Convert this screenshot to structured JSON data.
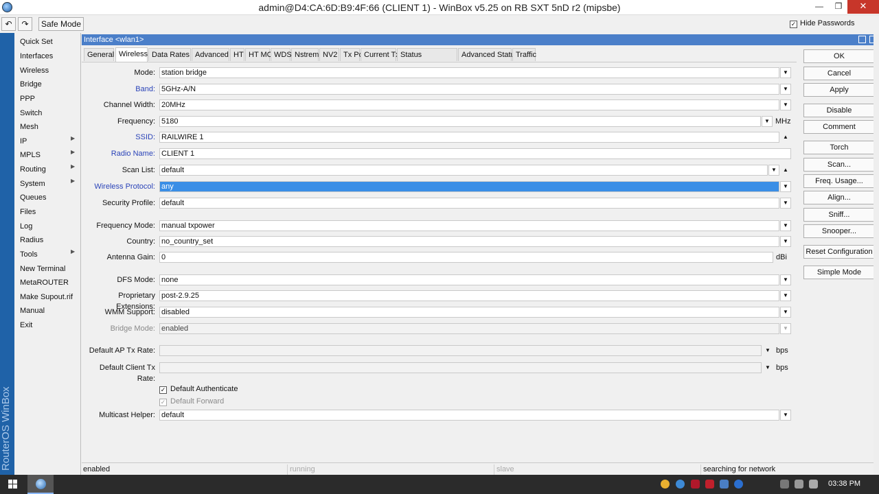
{
  "window": {
    "title": "admin@D4:CA:6D:B9:4F:66 (CLIENT 1) - WinBox v5.25 on RB SXT 5nD r2 (mipsbe)",
    "minimize_glyph": "—",
    "maximize_glyph": "❐",
    "close_glyph": "✕"
  },
  "toolbar": {
    "undo_icon": "↶",
    "redo_icon": "↷",
    "safe_mode_label": "Safe Mode",
    "hide_passwords_label": "Hide Passwords",
    "hide_passwords_checked": "✓"
  },
  "sidebar": {
    "brand": "RouterOS WinBox",
    "items": [
      {
        "label": "Quick Set",
        "submenu": false
      },
      {
        "label": "Interfaces",
        "submenu": false
      },
      {
        "label": "Wireless",
        "submenu": false
      },
      {
        "label": "Bridge",
        "submenu": false
      },
      {
        "label": "PPP",
        "submenu": false
      },
      {
        "label": "Switch",
        "submenu": false
      },
      {
        "label": "Mesh",
        "submenu": false
      },
      {
        "label": "IP",
        "submenu": true
      },
      {
        "label": "MPLS",
        "submenu": true
      },
      {
        "label": "Routing",
        "submenu": true
      },
      {
        "label": "System",
        "submenu": true
      },
      {
        "label": "Queues",
        "submenu": false
      },
      {
        "label": "Files",
        "submenu": false
      },
      {
        "label": "Log",
        "submenu": false
      },
      {
        "label": "Radius",
        "submenu": false
      },
      {
        "label": "Tools",
        "submenu": true
      },
      {
        "label": "New Terminal",
        "submenu": false
      },
      {
        "label": "MetaROUTER",
        "submenu": false
      },
      {
        "label": "Make Supout.rif",
        "submenu": false
      },
      {
        "label": "Manual",
        "submenu": false
      },
      {
        "label": "Exit",
        "submenu": false
      }
    ],
    "submenu_arrow": "▶"
  },
  "dialog": {
    "title": "Interface <wlan1>",
    "tabs": [
      "General",
      "Wireless",
      "Data Rates",
      "Advanced",
      "HT",
      "HT MCS",
      "WDS",
      "Nstreme",
      "NV2",
      "Tx Power",
      "Current Tx Power",
      "Status",
      "Advanced Status",
      "Traffic"
    ],
    "active_tab": "Wireless",
    "fields": {
      "mode": {
        "label": "Mode:",
        "value": "station bridge"
      },
      "band": {
        "label": "Band:",
        "value": "5GHz-A/N"
      },
      "channel_width": {
        "label": "Channel Width:",
        "value": "20MHz"
      },
      "frequency": {
        "label": "Frequency:",
        "value": "5180",
        "unit": "MHz"
      },
      "ssid": {
        "label": "SSID:",
        "value": "RAILWIRE 1"
      },
      "radio_name": {
        "label": "Radio Name:",
        "value": "CLIENT 1"
      },
      "scan_list": {
        "label": "Scan List:",
        "value": "default"
      },
      "wireless_protocol": {
        "label": "Wireless Protocol:",
        "value": "any"
      },
      "security_profile": {
        "label": "Security Profile:",
        "value": "default"
      },
      "frequency_mode": {
        "label": "Frequency Mode:",
        "value": "manual txpower"
      },
      "country": {
        "label": "Country:",
        "value": "no_country_set"
      },
      "antenna_gain": {
        "label": "Antenna Gain:",
        "value": "0",
        "unit": "dBi"
      },
      "dfs_mode": {
        "label": "DFS Mode:",
        "value": "none"
      },
      "proprietary_extensions": {
        "label": "Proprietary Extensions:",
        "value": "post-2.9.25"
      },
      "wmm_support": {
        "label": "WMM Support:",
        "value": "disabled"
      },
      "bridge_mode": {
        "label": "Bridge Mode:",
        "value": "enabled"
      },
      "default_ap_tx_rate": {
        "label": "Default AP Tx Rate:",
        "value": "",
        "unit": "bps"
      },
      "default_client_tx_rate": {
        "label": "Default Client Tx Rate:",
        "value": "",
        "unit": "bps"
      },
      "multicast_helper": {
        "label": "Multicast Helper:",
        "value": "default"
      }
    },
    "checkboxes": {
      "default_authenticate": {
        "label": "Default Authenticate",
        "checked": "✓"
      },
      "default_forward": {
        "label": "Default Forward",
        "checked": "✓"
      }
    },
    "dropdown_glyph": "▼",
    "up_glyph": "▲",
    "buttons": [
      "OK",
      "Cancel",
      "Apply",
      "Disable",
      "Comment",
      "Torch",
      "Scan...",
      "Freq. Usage...",
      "Align...",
      "Sniff...",
      "Snooper...",
      "Reset Configuration",
      "Simple Mode"
    ],
    "status": {
      "state": "enabled",
      "running": "running",
      "slave": "slave",
      "message": "searching for network"
    }
  },
  "taskbar": {
    "clock": "03:38 PM"
  }
}
